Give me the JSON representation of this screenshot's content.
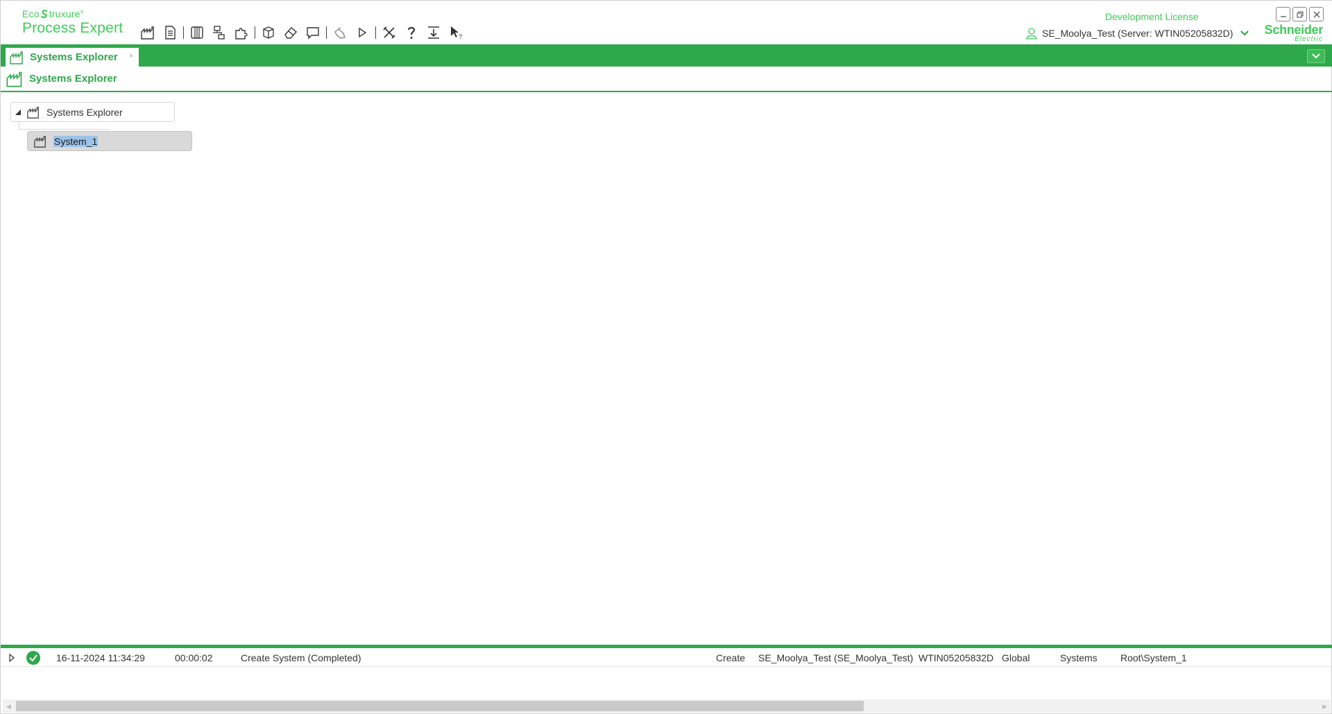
{
  "app": {
    "brand_eco": "Eco",
    "brand_struxure": "truxure",
    "product": "Process Expert",
    "license": "Development License",
    "user": "SE_Moolya_Test (Server: WTIN05205832D)",
    "logo_line1": "Schneider",
    "logo_line2": "Electric",
    "accent_color": "#3dcd58",
    "bar_color": "#2ea84a"
  },
  "toolbar": {
    "icons": [
      "factory-icon",
      "document-icon",
      "library-icon",
      "network-icon",
      "puzzle-icon",
      "box-icon",
      "eraser-icon",
      "speech-bubble-icon",
      "hand-icon",
      "play-icon",
      "tools-icon",
      "help-icon",
      "export-icon",
      "pointer-help-icon"
    ]
  },
  "tabs": [
    {
      "label": "Systems Explorer",
      "close": "×",
      "active": true
    }
  ],
  "panel": {
    "title": "Systems Explorer"
  },
  "tree": {
    "root": {
      "label": "Systems Explorer",
      "expanded": true
    },
    "children": [
      {
        "label": "System_1",
        "selected": true
      }
    ]
  },
  "log": {
    "rows": [
      {
        "timestamp": "16-11-2024 11:34:29",
        "duration": "00:00:02",
        "description": "Create System (Completed)",
        "action": "Create",
        "user": "SE_Moolya_Test (SE_Moolya_Test)",
        "machine": "WTIN05205832D",
        "scope": "Global",
        "category": "Systems",
        "path": "Root\\System_1"
      }
    ]
  }
}
